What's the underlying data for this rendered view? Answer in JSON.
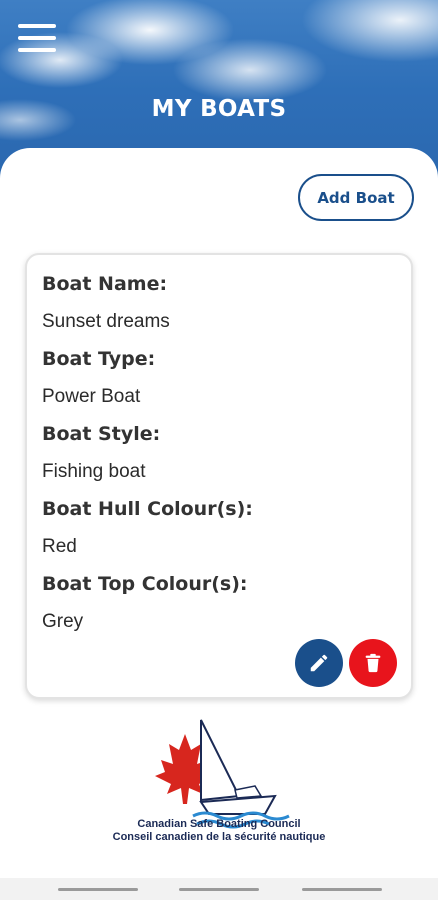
{
  "header": {
    "title": "MY BOATS",
    "menu_icon": "hamburger-menu-icon"
  },
  "actions": {
    "add_boat_label": "Add Boat"
  },
  "boat": {
    "fields": [
      {
        "label": "Boat Name:",
        "value": "Sunset dreams"
      },
      {
        "label": "Boat Type:",
        "value": "Power Boat"
      },
      {
        "label": "Boat Style:",
        "value": "Fishing boat"
      },
      {
        "label": "Boat Hull Colour(s):",
        "value": "Red"
      },
      {
        "label": "Boat Top Colour(s):",
        "value": "Grey"
      }
    ],
    "edit_icon": "pencil-icon",
    "delete_icon": "trash-icon"
  },
  "logo": {
    "line_en": "Canadian Safe Boating Council",
    "line_fr": "Conseil canadien de la sécurité nautique"
  },
  "colors": {
    "primary": "#1a4f8b",
    "danger": "#e8141c",
    "sky": "#2e6fb8"
  }
}
